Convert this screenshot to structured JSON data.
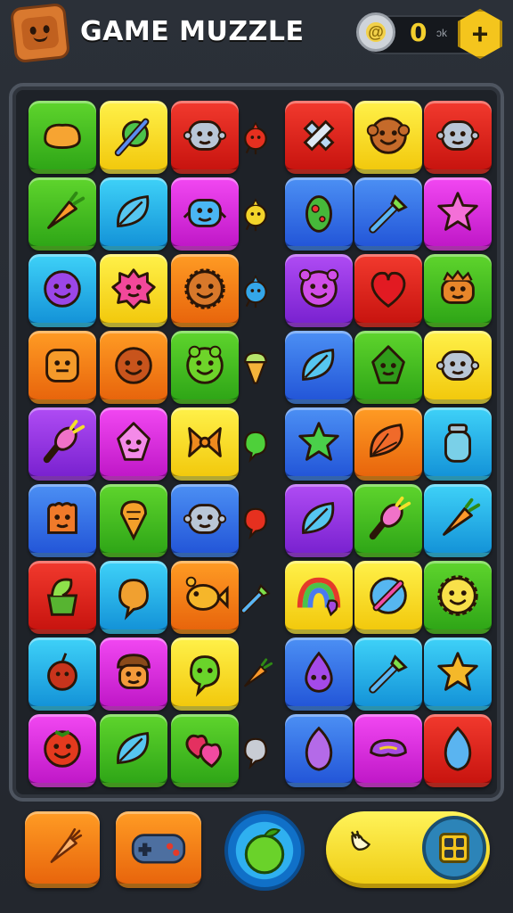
{
  "header": {
    "title": "GAME MUZZLE",
    "coins": "0",
    "coins_suffix": "ɔk",
    "coin_icon": "gear-coin-icon",
    "add_icon": "plus-icon",
    "logo_icon": "orange-block-face-icon"
  },
  "board": {
    "rows": 9,
    "columns": 7,
    "tiles": [
      [
        "green:bread-icon",
        "yellow:pencil-icon",
        "red:robot-face-icon",
        "mini-red:bird-icon",
        "red:cross-icon",
        "yellow:monkey-face-icon",
        "red:robot-face-icon"
      ],
      [
        "green:carrot-icon",
        "cyan:leaf-icon",
        "magenta:monster-face-icon",
        "mini-yellow:bird-icon",
        "blue:pepper-icon",
        "blue:brush-icon",
        "magenta:star-icon"
      ],
      [
        "cyan:smiley-face-icon",
        "yellow:spiky-face-icon",
        "orange:lion-face-icon",
        "mini-blue:bird-icon",
        "purple:bear-face-icon",
        "red:heart-icon",
        "green:crab-face-icon"
      ],
      [
        "orange:block-face-icon",
        "orange:ball-face-icon",
        "green:frog-face-icon",
        "mini-orange:ice-cream-icon",
        "blue:leaf-icon",
        "green:gem-face-icon",
        "yellow:robot-face-icon"
      ],
      [
        "purple:radish-icon",
        "magenta:gem-face-icon",
        "yellow:bow-icon",
        "mini-green:blob-icon",
        "blue:star-icon",
        "orange:shell-icon",
        "cyan:jar-icon"
      ],
      [
        "blue:cookie-face-icon",
        "green:corn-icon",
        "blue:robot-face-icon",
        "mini-red:blob-icon",
        "purple:leaf-icon",
        "green:radish-icon",
        "cyan:carrot-icon"
      ],
      [
        "red:cup-icon",
        "cyan:blob-icon",
        "orange:fish-icon",
        "mini-gray:brush-icon",
        "yellow:rainbow-icon",
        "yellow:compass-icon",
        "green:sun-face-icon"
      ],
      [
        "cyan:cherry-icon",
        "magenta:acorn-face-icon",
        "yellow:blob-face-icon",
        "mini-orange:carrot-icon",
        "blue:drop-face-icon",
        "cyan:brush-icon",
        "cyan:star-icon"
      ],
      [
        "magenta:tomato-face-icon",
        "green:leaf-icon",
        "green:hearts-icon",
        "mini-gray:blob-icon",
        "blue:gem-icon",
        "magenta:hat-icon",
        "red:gem-icon"
      ]
    ]
  },
  "toolbar": {
    "button1_icon": "carrot-icon",
    "button2_icon": "gamepad-icon",
    "button3_icon": "apple-icon",
    "pill_icon": "hand-icon",
    "grid_icon": "grid-icon"
  },
  "colors": {
    "green": "#3fbf1f",
    "yellow": "#f8dc22",
    "red": "#e02a20",
    "cyan": "#27b4ec",
    "magenta": "#de30e0",
    "blue": "#3a74e8",
    "purple": "#9838e6",
    "orange": "#f68216"
  }
}
